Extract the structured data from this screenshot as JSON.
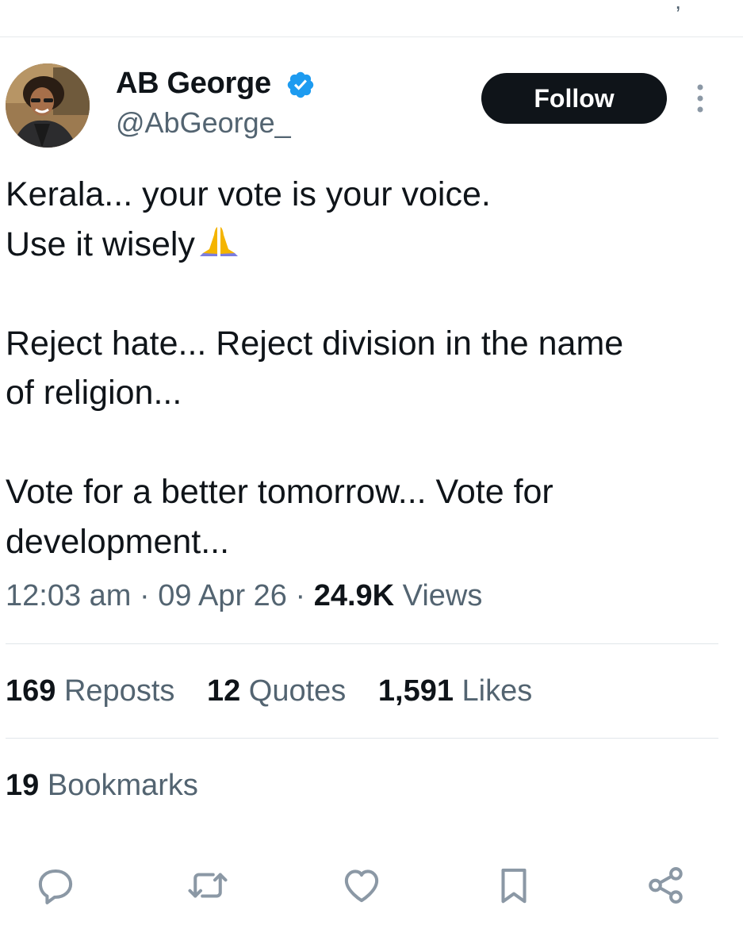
{
  "author": {
    "display_name": "AB George",
    "handle": "@AbGeorge_",
    "verified": true
  },
  "follow_label": "Follow",
  "tweet": {
    "lines": [
      "Kerala... your vote is your voice.",
      "Use it wisely",
      "",
      "Reject hate... Reject division in the name",
      "of religion...",
      "",
      "Vote for a better tomorrow... Vote for",
      "development..."
    ],
    "emoji": "folded-hands-icon"
  },
  "meta": {
    "time": "12:03 am",
    "date": "09 Apr 26",
    "views_count": "24.9K",
    "views_label": "Views",
    "separator": "·"
  },
  "stats": {
    "reposts_count": "169",
    "reposts_label": "Reposts",
    "quotes_count": "12",
    "quotes_label": "Quotes",
    "likes_count": "1,591",
    "likes_label": "Likes",
    "bookmarks_count": "19",
    "bookmarks_label": "Bookmarks"
  },
  "actions": [
    "reply-icon",
    "repost-icon",
    "like-icon",
    "bookmark-icon",
    "share-icon"
  ],
  "colors": {
    "text_primary": "#0f1419",
    "text_secondary": "#536471",
    "verified_blue": "#1d9bf0",
    "follow_bg": "#0f1419",
    "divider": "#e1e6ea"
  }
}
